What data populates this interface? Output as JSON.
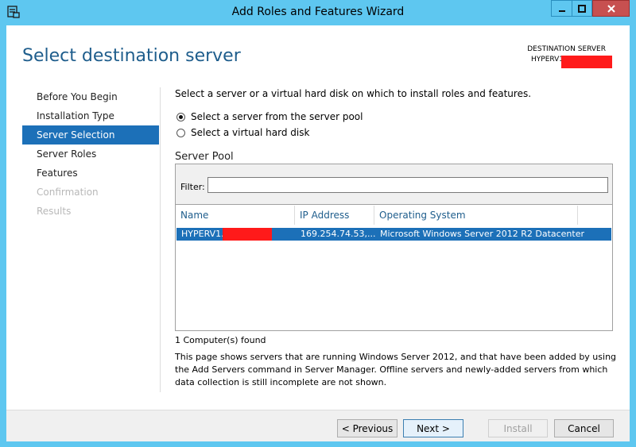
{
  "window": {
    "title": "Add Roles and Features Wizard",
    "close_glyph": "✕",
    "minimize_glyph": "▁",
    "maximize_glyph": "☐"
  },
  "header": {
    "page_title": "Select destination server",
    "destination_label": "DESTINATION SERVER",
    "destination_server": "HYPERV1"
  },
  "nav": {
    "items": [
      {
        "label": "Before You Begin"
      },
      {
        "label": "Installation Type"
      },
      {
        "label": "Server Selection"
      },
      {
        "label": "Server Roles"
      },
      {
        "label": "Features"
      },
      {
        "label": "Confirmation"
      },
      {
        "label": "Results"
      }
    ]
  },
  "main": {
    "instruction": "Select a server or a virtual hard disk on which to install roles and features.",
    "option_pool": "Select a server from the server pool",
    "option_vhd": "Select a virtual hard disk",
    "pool_heading": "Server Pool",
    "filter_label": "Filter:",
    "filter_value": "",
    "columns": [
      "Name",
      "IP Address",
      "Operating System"
    ],
    "rows": [
      {
        "name": "HYPERV1.",
        "ip": "169.254.74.53,...",
        "os": "Microsoft Windows Server 2012 R2 Datacenter"
      }
    ],
    "found_text": "1 Computer(s) found",
    "description": "This page shows servers that are running Windows Server 2012, and that have been added by using the Add Servers command in Server Manager. Offline servers and newly-added servers from which data collection is still incomplete are not shown."
  },
  "footer": {
    "previous": "< Previous",
    "next": "Next >",
    "install": "Install",
    "cancel": "Cancel"
  },
  "colors": {
    "accent": "#1c70b8",
    "titlebar": "#5ec7f0",
    "heading": "#1e5d8c",
    "close": "#c75050",
    "redaction": "#ff1a1a"
  }
}
